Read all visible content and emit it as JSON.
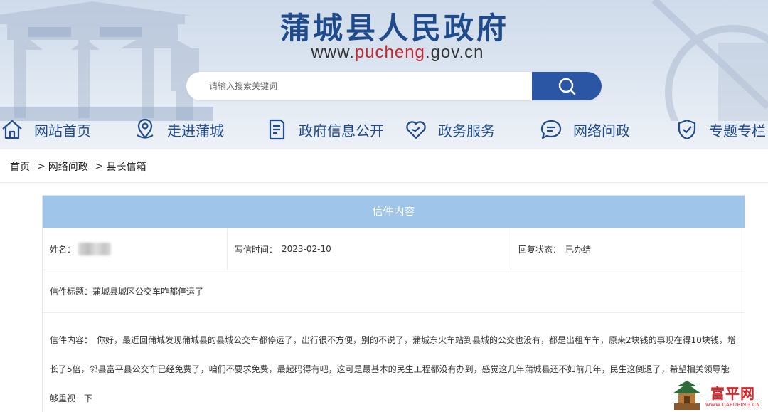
{
  "header": {
    "title": "蒲城县人民政府",
    "url_prefix": "www.",
    "url_highlight": "pucheng",
    "url_suffix": ".gov.cn",
    "brand_color": "#1f4a8c",
    "accent_color": "#c8272c"
  },
  "search": {
    "placeholder": "请输入搜索关键词",
    "button_icon": "search-icon",
    "button_color": "#2a56a4"
  },
  "nav": {
    "items": [
      {
        "label": "网站首页",
        "icon": "home-icon"
      },
      {
        "label": "走进蒲城",
        "icon": "location-pin-icon"
      },
      {
        "label": "政府信息公开",
        "icon": "document-icon"
      },
      {
        "label": "政务服务",
        "icon": "heart-icon"
      },
      {
        "label": "网络问政",
        "icon": "chat-bubble-icon"
      },
      {
        "label": "专题专栏",
        "icon": "shield-check-icon"
      }
    ]
  },
  "breadcrumb": {
    "items": [
      "首页",
      "网络问政",
      "县长信箱"
    ],
    "separator": ">"
  },
  "letter": {
    "header": "信件内容",
    "header_color": "#9fc5ea",
    "name_label": "姓名：",
    "time_label": "写信时间：",
    "time_value": "2023-02-10",
    "status_label": "回复状态：",
    "status_value": "已办结",
    "subject_label": "信件标题：",
    "subject_value": "蒲城县城区公交车咋都停运了",
    "content_label": "信件内容：",
    "content_value": "你好，最近回蒲城发现蒲城县的县城公交车都停运了，出行很不方便，别的不说了，蒲城东火车站到县城的公交也没有，都是出租车车，原来2块钱的事现在得10块钱，增长了5倍，邻县富平县公交车已经免费了，咱们不要求免费，最起码得有吧，这可是最基本的民生工程都没有办到，感觉这几年蒲城县还不如前几年，民生这倒退了，希望相关领导能够重视一下"
  },
  "watermark": {
    "name": "富平网",
    "domain": "WWW.DAFUPING.CN"
  }
}
